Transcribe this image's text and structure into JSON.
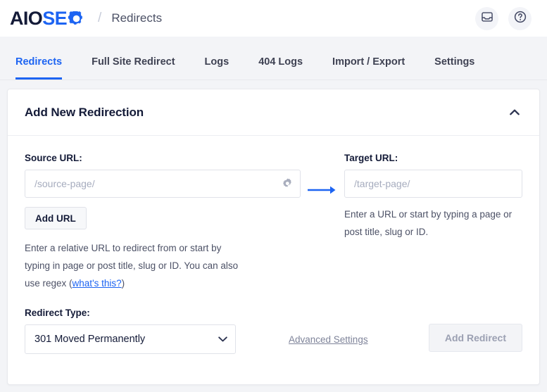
{
  "header": {
    "logo": {
      "part1": "AIO",
      "part2": "SE",
      "gear_icon": "gear-o-icon"
    },
    "breadcrumb_separator": "/",
    "breadcrumb_title": "Redirects",
    "actions": [
      {
        "icon": "inbox-icon",
        "name": "notifications-button"
      },
      {
        "icon": "question-circle-icon",
        "name": "help-button"
      }
    ]
  },
  "tabs": [
    {
      "label": "Redirects",
      "active": true
    },
    {
      "label": "Full Site Redirect",
      "active": false
    },
    {
      "label": "Logs",
      "active": false
    },
    {
      "label": "404 Logs",
      "active": false
    },
    {
      "label": "Import / Export",
      "active": false
    },
    {
      "label": "Settings",
      "active": false
    }
  ],
  "card": {
    "title": "Add New Redirection",
    "collapse_icon": "chevron-up-icon"
  },
  "source": {
    "label": "Source URL:",
    "placeholder": "/source-page/",
    "value": "",
    "gear_icon": "gear-icon",
    "add_url_label": "Add URL",
    "helper_prefix": "Enter a relative URL to redirect from or start by typing in page or post title, slug or ID. You can also use regex (",
    "helper_link": "what's this?",
    "helper_suffix": ")"
  },
  "arrow": {
    "icon": "arrow-right-icon"
  },
  "target": {
    "label": "Target URL:",
    "placeholder": "/target-page/",
    "value": "",
    "helper": "Enter a URL or start by typing a page or post title, slug or ID."
  },
  "redirect_type": {
    "label": "Redirect Type:",
    "selected": "301 Moved Permanently",
    "chevron_icon": "chevron-down-icon",
    "options": [
      "301 Moved Permanently"
    ]
  },
  "advanced_settings_label": "Advanced Settings",
  "submit": {
    "label": "Add Redirect",
    "disabled": true
  },
  "colors": {
    "accent": "#1D64F2",
    "navy": "#141B38",
    "page_bg": "#F3F4F7",
    "border": "#E0E2E9",
    "muted": "#7E8399"
  }
}
